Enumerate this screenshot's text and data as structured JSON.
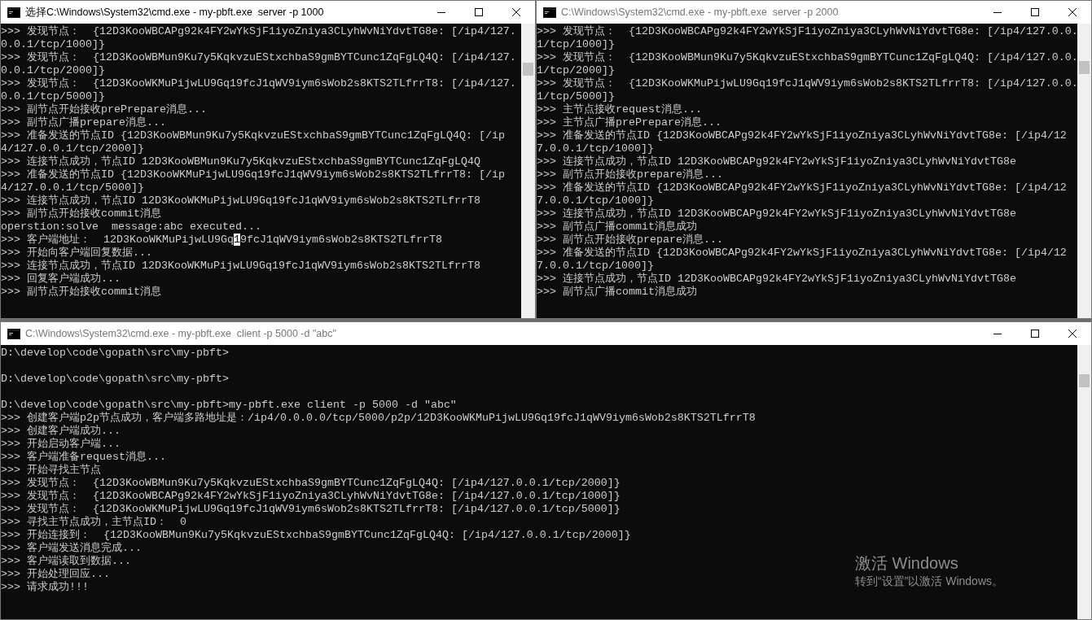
{
  "windows": [
    {
      "title": "选择C:\\Windows\\System32\\cmd.exe - my-pbft.exe  server -p 1000",
      "active": true,
      "lines": [
        {
          "text": ">>> 发现节点：  {12D3KooWBCAPg92k4FY2wYkSjF1iyoZniya3CLyhWvNiYdvtTG8e: [/ip4/127."
        },
        {
          "text": "0.0.1/tcp/1000]}"
        },
        {
          "text": ">>> 发现节点：  {12D3KooWBMun9Ku7y5KqkvzuEStxchbaS9gmBYTCunc1ZqFgLQ4Q: [/ip4/127."
        },
        {
          "text": "0.0.1/tcp/2000]}"
        },
        {
          "text": ">>> 发现节点：  {12D3KooWKMuPijwLU9Gq19fcJ1qWV9iym6sWob2s8KTS2TLfrrT8: [/ip4/127."
        },
        {
          "text": "0.0.1/tcp/5000]}"
        },
        {
          "text": ">>> 副节点开始接收prePrepare消息..."
        },
        {
          "text": ">>> 副节点广播prepare消息..."
        },
        {
          "text": ">>> 准备发送的节点ID {12D3KooWBMun9Ku7y5KqkvzuEStxchbaS9gmBYTCunc1ZqFgLQ4Q: [/ip"
        },
        {
          "text": "4/127.0.0.1/tcp/2000]}"
        },
        {
          "text": ">>> 连接节点成功，节点ID 12D3KooWBMun9Ku7y5KqkvzuEStxchbaS9gmBYTCunc1ZqFgLQ4Q"
        },
        {
          "text": ">>> 准备发送的节点ID {12D3KooWKMuPijwLU9Gq19fcJ1qWV9iym6sWob2s8KTS2TLfrrT8: [/ip"
        },
        {
          "text": "4/127.0.0.1/tcp/5000]}"
        },
        {
          "text": ">>> 连接节点成功，节点ID 12D3KooWKMuPijwLU9Gq19fcJ1qWV9iym6sWob2s8KTS2TLfrrT8"
        },
        {
          "text": ">>> 副节点开始接收commit消息"
        },
        {
          "text": "operstion:solve  message:abc executed..."
        },
        {
          "parts": [
            {
              "text": ">>> 客户端地址：  12D3KooWKMuPijwLU9Gq",
              "selected": false
            },
            {
              "text": "1",
              "selected": true
            },
            {
              "text": "9fcJ1qWV9iym6sWob2s8KTS2TLfrrT8",
              "selected": false
            }
          ]
        },
        {
          "text": ">>> 开始向客户端回复数据..."
        },
        {
          "text": ">>> 连接节点成功，节点ID 12D3KooWKMuPijwLU9Gq19fcJ1qWV9iym6sWob2s8KTS2TLfrrT8"
        },
        {
          "text": ">>> 回复客户端成功..."
        },
        {
          "text": ">>> 副节点开始接收commit消息"
        }
      ]
    },
    {
      "title": "C:\\Windows\\System32\\cmd.exe - my-pbft.exe  server -p 2000",
      "active": false,
      "lines": [
        {
          "text": ">>> 发现节点：  {12D3KooWBCAPg92k4FY2wYkSjF1iyoZniya3CLyhWvNiYdvtTG8e: [/ip4/127.0.0."
        },
        {
          "text": "1/tcp/1000]}"
        },
        {
          "text": ">>> 发现节点：  {12D3KooWBMun9Ku7y5KqkvzuEStxchbaS9gmBYTCunc1ZqFgLQ4Q: [/ip4/127.0.0."
        },
        {
          "text": "1/tcp/2000]}"
        },
        {
          "text": ">>> 发现节点：  {12D3KooWKMuPijwLU9Gq19fcJ1qWV9iym6sWob2s8KTS2TLfrrT8: [/ip4/127.0.0."
        },
        {
          "text": "1/tcp/5000]}"
        },
        {
          "text": ">>> 主节点接收request消息..."
        },
        {
          "text": ">>> 主节点广播prePrepare消息..."
        },
        {
          "text": ">>> 准备发送的节点ID {12D3KooWBCAPg92k4FY2wYkSjF1iyoZniya3CLyhWvNiYdvtTG8e: [/ip4/12"
        },
        {
          "text": "7.0.0.1/tcp/1000]}"
        },
        {
          "text": ">>> 连接节点成功，节点ID 12D3KooWBCAPg92k4FY2wYkSjF1iyoZniya3CLyhWvNiYdvtTG8e"
        },
        {
          "text": ">>> 副节点开始接收prepare消息..."
        },
        {
          "text": ">>> 准备发送的节点ID {12D3KooWBCAPg92k4FY2wYkSjF1iyoZniya3CLyhWvNiYdvtTG8e: [/ip4/12"
        },
        {
          "text": "7.0.0.1/tcp/1000]}"
        },
        {
          "text": ">>> 连接节点成功，节点ID 12D3KooWBCAPg92k4FY2wYkSjF1iyoZniya3CLyhWvNiYdvtTG8e"
        },
        {
          "text": ">>> 副节点广播commit消息成功"
        },
        {
          "text": ">>> 副节点开始接收prepare消息..."
        },
        {
          "text": ">>> 准备发送的节点ID {12D3KooWBCAPg92k4FY2wYkSjF1iyoZniya3CLyhWvNiYdvtTG8e: [/ip4/12"
        },
        {
          "text": "7.0.0.1/tcp/1000]}"
        },
        {
          "text": ">>> 连接节点成功，节点ID 12D3KooWBCAPg92k4FY2wYkSjF1iyoZniya3CLyhWvNiYdvtTG8e"
        },
        {
          "text": ">>> 副节点广播commit消息成功"
        }
      ]
    },
    {
      "title": "C:\\Windows\\System32\\cmd.exe - my-pbft.exe  client -p 5000 -d \"abc\"",
      "active": false,
      "lines": [
        {
          "text": "D:\\develop\\code\\gopath\\src\\my-pbft>"
        },
        {
          "kind": "blank"
        },
        {
          "text": "D:\\develop\\code\\gopath\\src\\my-pbft>"
        },
        {
          "kind": "blank"
        },
        {
          "text": "D:\\develop\\code\\gopath\\src\\my-pbft>my-pbft.exe client -p 5000 -d \"abc\""
        },
        {
          "text": ">>> 创建客户端p2p节点成功，客户端多路地址是：/ip4/0.0.0.0/tcp/5000/p2p/12D3KooWKMuPijwLU9Gq19fcJ1qWV9iym6sWob2s8KTS2TLfrrT8"
        },
        {
          "text": ">>> 创建客户端成功..."
        },
        {
          "text": ">>> 开始启动客户端..."
        },
        {
          "text": ">>> 客户端准备request消息..."
        },
        {
          "text": ">>> 开始寻找主节点"
        },
        {
          "text": ">>> 发现节点：  {12D3KooWBMun9Ku7y5KqkvzuEStxchbaS9gmBYTCunc1ZqFgLQ4Q: [/ip4/127.0.0.1/tcp/2000]}"
        },
        {
          "text": ">>> 发现节点：  {12D3KooWBCAPg92k4FY2wYkSjF1iyoZniya3CLyhWvNiYdvtTG8e: [/ip4/127.0.0.1/tcp/1000]}"
        },
        {
          "text": ">>> 发现节点：  {12D3KooWKMuPijwLU9Gq19fcJ1qWV9iym6sWob2s8KTS2TLfrrT8: [/ip4/127.0.0.1/tcp/5000]}"
        },
        {
          "text": ">>> 寻找主节点成功，主节点ID：  0"
        },
        {
          "text": ">>> 开始连接到：  {12D3KooWBMun9Ku7y5KqkvzuEStxchbaS9gmBYTCunc1ZqFgLQ4Q: [/ip4/127.0.0.1/tcp/2000]}"
        },
        {
          "text": ">>> 客户端发送消息完成..."
        },
        {
          "text": ">>> 客户端读取到数据..."
        },
        {
          "text": ">>> 开始处理回应..."
        },
        {
          "text": ">>> 请求成功!!!"
        }
      ]
    }
  ],
  "activation_notice": {
    "title": "激活 Windows",
    "subtitle": "转到“设置”以激活 Windows。"
  }
}
